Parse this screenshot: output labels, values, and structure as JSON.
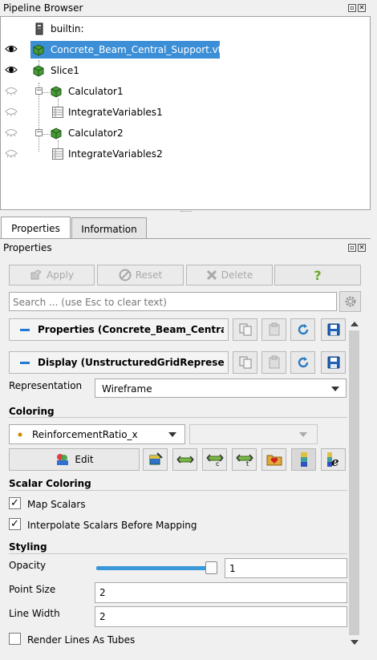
{
  "pipeline_browser": {
    "title": "Pipeline Browser",
    "items": [
      {
        "label": "builtin:"
      },
      {
        "label": "Concrete_Beam_Central_Support.vtk"
      },
      {
        "label": "Slice1"
      },
      {
        "label": "Calculator1"
      },
      {
        "label": "IntegrateVariables1"
      },
      {
        "label": "Calculator2"
      },
      {
        "label": "IntegrateVariables2"
      }
    ]
  },
  "tabs": [
    {
      "label": "Properties"
    },
    {
      "label": "Information"
    }
  ],
  "properties": {
    "title": "Properties",
    "apply_label": "Apply",
    "reset_label": "Reset",
    "delete_label": "Delete",
    "help_label": "?",
    "search_placeholder": "Search ... (use Esc to clear text)",
    "section_properties": "Properties (Concrete_Beam_Central_Support.vtk)",
    "section_display": "Display (UnstructuredGridRepresentation)",
    "representation_label": "Representation",
    "representation_value": "Wireframe",
    "coloring_heading": "Coloring",
    "coloring_value": "ReinforcementRatio_x",
    "edit_label": "Edit",
    "scalar_coloring_heading": "Scalar Coloring",
    "map_scalars_label": "Map Scalars",
    "interpolate_label": "Interpolate Scalars Before Mapping",
    "styling_heading": "Styling",
    "opacity_label": "Opacity",
    "opacity_value": "1",
    "opacity_slider_level": 1.0,
    "point_size_label": "Point Size",
    "point_size_value": "2",
    "line_width_label": "Line Width",
    "line_width_value": "2",
    "render_tubes_label": "Render Lines As Tubes"
  },
  "colors": {
    "selection": "#3c8fd6",
    "accent": "#1e7ad2",
    "slider": "#3a97d8"
  }
}
